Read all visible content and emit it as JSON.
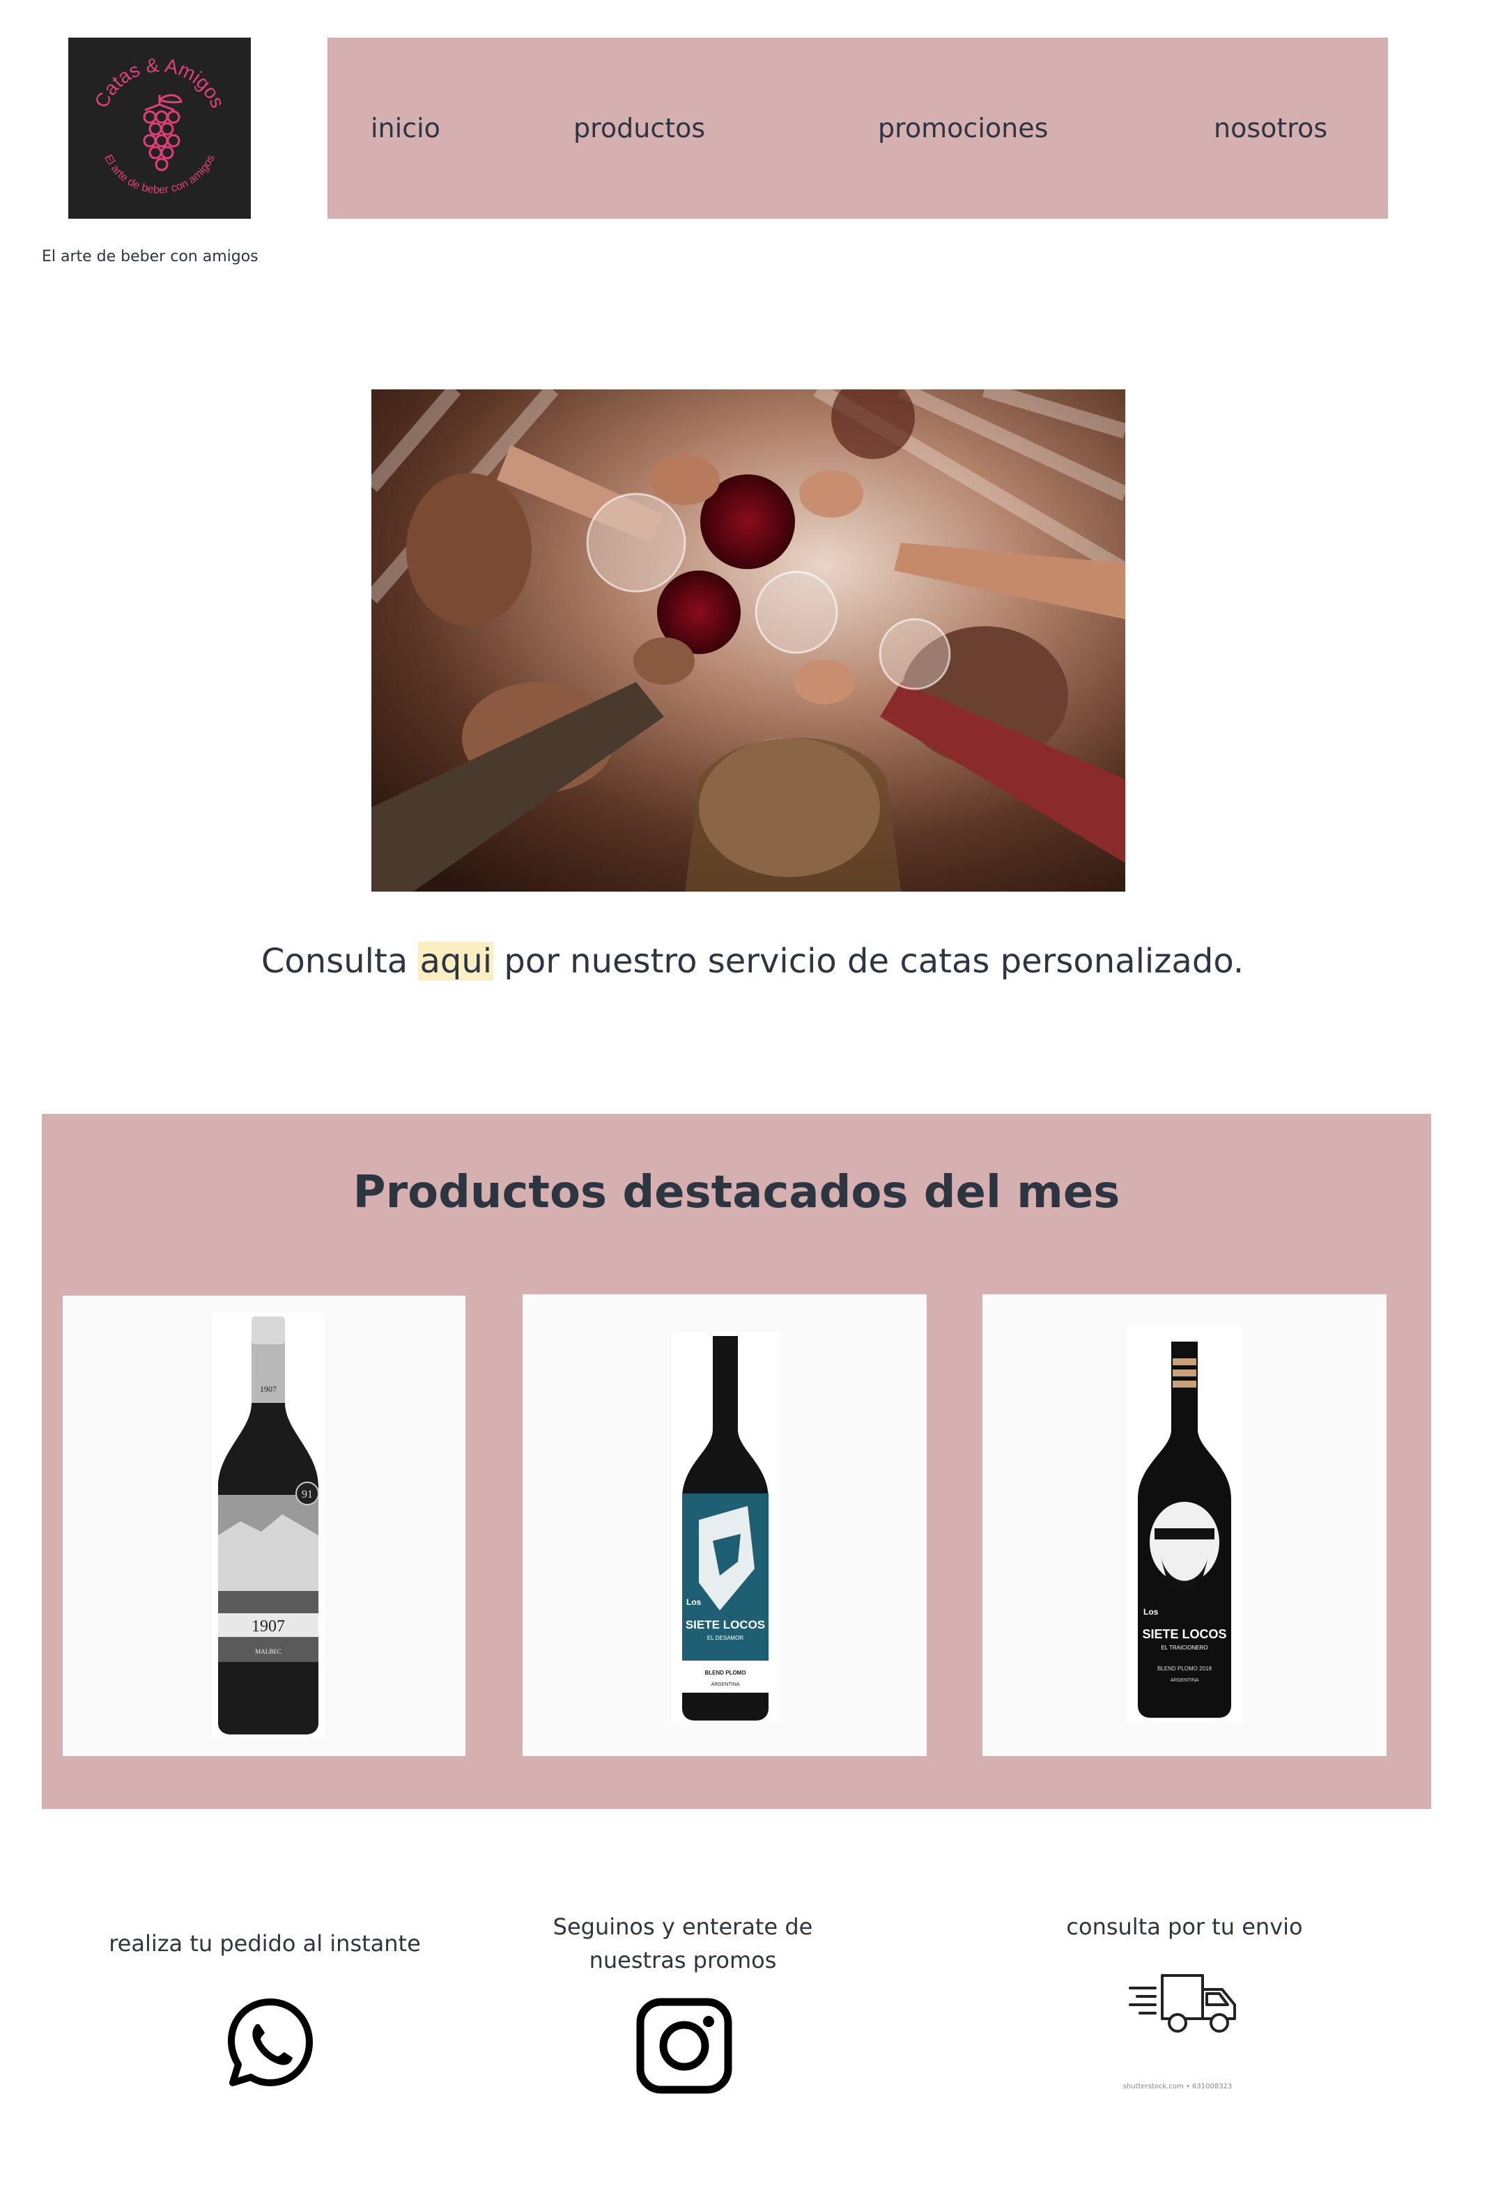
{
  "brand": {
    "logo_name": "Catas & Amigos",
    "logo_subtitle": "El arte de beber con amigos",
    "tagline": "El arte de beber con amigos",
    "accent_color": "#e0407a"
  },
  "nav": {
    "background": "#d6b0b0",
    "items": [
      {
        "label": "inicio"
      },
      {
        "label": "productos"
      },
      {
        "label": "promociones"
      },
      {
        "label": "nosotros"
      }
    ]
  },
  "hero": {
    "image": "friends-toasting-wine-photo"
  },
  "consult": {
    "before": "Consulta ",
    "link": "aqui",
    "after": " por nuestro servicio de catas personalizado."
  },
  "featured": {
    "title": "Productos destacados del mes",
    "products": [
      {
        "label_top": "1907",
        "label_main": "1907",
        "badge": "91",
        "variety": "MALBEC"
      },
      {
        "label_top": "Los",
        "label_main": "SIETE LOCOS",
        "sub": "EL DESAMOR",
        "line": "BLEND PLOMO",
        "country": "ARGENTINA"
      },
      {
        "label_top": "Los",
        "label_main": "SIETE LOCOS",
        "sub": "EL TRAICIONERO",
        "line": "BLEND PLOMO 2018",
        "country": "ARGENTINA"
      }
    ]
  },
  "footer": {
    "order": {
      "text": "realiza tu pedido al instante",
      "icon": "whatsapp-icon"
    },
    "follow": {
      "line1": "Seguinos y enterate de",
      "line2": "nuestras promos",
      "icon": "instagram-icon"
    },
    "shipping": {
      "text": "consulta por tu envio",
      "icon": "delivery-truck-icon",
      "credit": "shutterstock.com • 631008323"
    }
  }
}
